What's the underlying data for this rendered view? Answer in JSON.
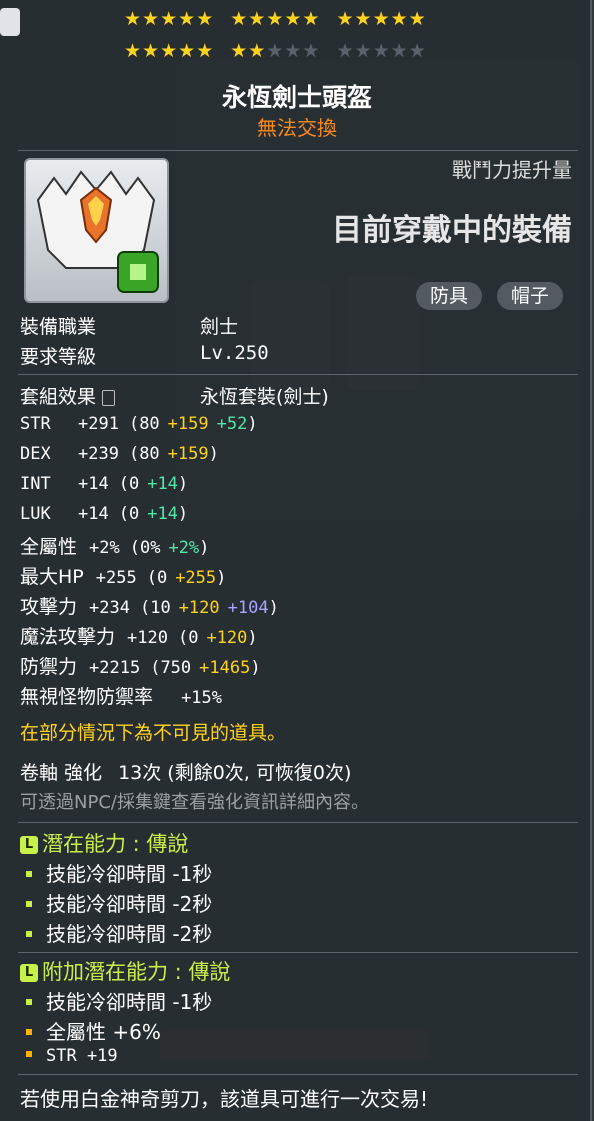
{
  "item": {
    "name": "永恆劍士頭盔",
    "trade_status": "無法交換",
    "star_rows": [
      {
        "groups": [
          5,
          5,
          5
        ],
        "filled": 15
      },
      {
        "groups": [
          5,
          5,
          5
        ],
        "filled": 7
      }
    ],
    "combat_label": "戰鬥力提升量",
    "combat_value": "目前穿戴中的裝備",
    "tags": [
      "防具",
      "帽子"
    ],
    "job_label": "裝備職業",
    "job_value": "劍士",
    "level_label": "要求等級",
    "level_value": "Lv.250",
    "set_label": "套組效果",
    "set_value": "永恆套裝(劍士)"
  },
  "stats": [
    {
      "name": "STR",
      "total": "+291",
      "base": "(80",
      "a": "+159",
      "b": "+52",
      "c": "",
      ")": ")"
    },
    {
      "name": "DEX",
      "total": "+239",
      "base": "(80",
      "a": "+159",
      "b": "",
      "c": "",
      ")": ")"
    },
    {
      "name": "INT",
      "total": "+14",
      "base": "(0",
      "a": "",
      "b": "+14",
      "c": "",
      ")": ")"
    },
    {
      "name": "LUK",
      "total": "+14",
      "base": "(0",
      "a": "",
      "b": "+14",
      "c": "",
      ")": ")"
    },
    {
      "name": "全屬性",
      "total": "+2%",
      "base": "(0%",
      "a": "",
      "b": "+2%",
      "c": "",
      ")": ")"
    },
    {
      "name": "最大HP",
      "total": "+255",
      "base": "(0",
      "a": "+255",
      "b": "",
      "c": "",
      ")": ")"
    },
    {
      "name": "攻擊力",
      "total": "+234",
      "base": "(10",
      "a": "+120",
      "b": "",
      "c": "+104",
      ")": ")"
    },
    {
      "name": "魔法攻擊力",
      "total": "+120",
      "base": "(0",
      "a": "+120",
      "b": "",
      "c": "",
      ")": ")"
    },
    {
      "name": "防禦力",
      "total": "+2215",
      "base": "(750",
      "a": "+1465",
      "b": "",
      "c": "",
      ")": ")"
    }
  ],
  "ignore_def": {
    "label": "無視怪物防禦率",
    "value": "+15%"
  },
  "invisible_note": "在部分情況下為不可見的道具。",
  "scroll": {
    "label": "卷軸 強化",
    "value": "13次 (剩餘0次, 可恢復0次)"
  },
  "npc_note": "可透過NPC/採集鍵查看強化資訊詳細內容。",
  "potential": {
    "title": "潛在能力 : 傳說",
    "lines": [
      "技能冷卻時間 -1秒",
      "技能冷卻時間 -2秒",
      "技能冷卻時間 -2秒"
    ]
  },
  "bonus_potential": {
    "title": "附加潛在能力 : 傳說",
    "lines": [
      {
        "text": "技能冷卻時間 -1秒",
        "color": "green"
      },
      {
        "text": "全屬性 +6%",
        "color": "orange"
      },
      {
        "text": "STR +19",
        "color": "orange"
      }
    ]
  },
  "footer_note": "若使用白金神奇剪刀，該道具可進行一次交易!",
  "legend_icon": "L",
  "colors": {
    "gold": "#ffd21e",
    "green": "#53e6a8",
    "purple": "#a9a2ff",
    "orange": "#ff8a1c",
    "legend": "#c8f04a"
  }
}
